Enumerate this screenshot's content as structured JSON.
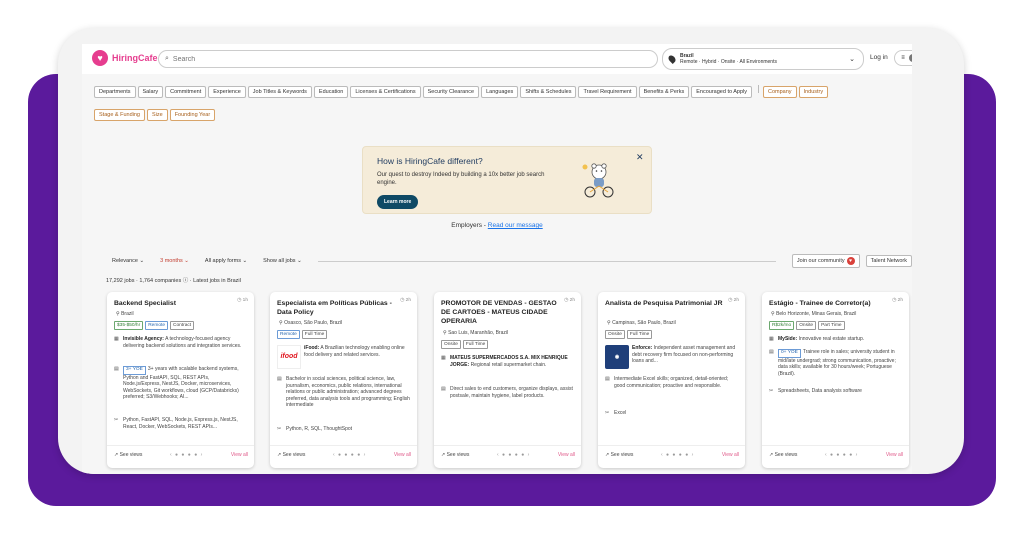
{
  "brand": {
    "name": "HiringCafe",
    "accent": "#e63d8f",
    "frame_bg": "#5b1a9c"
  },
  "search": {
    "placeholder": "Search",
    "value": ""
  },
  "location": {
    "country": "Brazil",
    "modes": "Remote · Hybrid · Onsite · All Environments"
  },
  "header": {
    "login": "Log in",
    "menu_icon": "≡"
  },
  "filters": [
    {
      "label": "Departments"
    },
    {
      "label": "Salary"
    },
    {
      "label": "Commitment"
    },
    {
      "label": "Experience"
    },
    {
      "label": "Job Titles & Keywords"
    },
    {
      "label": "Education"
    },
    {
      "label": "Licenses & Certifications"
    },
    {
      "label": "Security Clearance"
    },
    {
      "label": "Languages"
    },
    {
      "label": "Shifts & Schedules"
    },
    {
      "label": "Travel Requirement"
    },
    {
      "label": "Benefits & Perks"
    },
    {
      "label": "Encouraged to Apply"
    }
  ],
  "company_filters": [
    {
      "label": "Company"
    },
    {
      "label": "Industry"
    },
    {
      "label": "Stage & Funding"
    },
    {
      "label": "Size"
    },
    {
      "label": "Founding Year"
    }
  ],
  "promo": {
    "title": "How is HiringCafe different?",
    "description": "Our quest to destroy Indeed by building a 10x better job search engine.",
    "button": "Learn more",
    "close": "✕"
  },
  "employers": {
    "label": "Employers -",
    "link": "Read our message"
  },
  "toolbar": {
    "relevance": "Relevance",
    "time": "3 months",
    "apply_forms": "All apply forms",
    "show_jobs": "Show all jobs",
    "community": "Join our community",
    "talent": "Talent Network"
  },
  "summary": {
    "count": "17,292 jobs · 1,764 companies",
    "latest": "· Latest jobs in Brazil"
  },
  "cards": [
    {
      "title": "Backend Specialist",
      "time": "1h",
      "location": "Brazil",
      "tags": [
        {
          "text": "$35-$50/hr",
          "style": "green"
        },
        {
          "text": "Remote",
          "style": "blue"
        },
        {
          "text": "Contract",
          "style": ""
        }
      ],
      "company": "Invisible Agency:",
      "company_desc": "A technology-focused agency delivering backend solutions and integration services.",
      "yoe": "3+ YOE",
      "requirements": "3+ years with scalable backend systems, Python and FastAPI, SQL, REST APIs, Node.js/Express, NestJS, Docker, microservices, WebSockets, Git workflows, cloud (GCP/Databricks) preferred; S3/Webhooks; AI...",
      "skills": "Python, FastAPI, SQL, Node.js, Express.js, NestJS, React, Docker, WebSockets, REST APIs...",
      "see_views": "See views",
      "view_all": "View all"
    },
    {
      "title": "Especialista em Políticas Públicas - Data Policy",
      "time": "2h",
      "location": "Osasco, São Paulo, Brazil",
      "tags": [
        {
          "text": "Remote",
          "style": "blue"
        },
        {
          "text": "Full Time",
          "style": ""
        }
      ],
      "logo": "ifood",
      "company": "iFood:",
      "company_desc": "A Brazilian technology enabling online food delivery and related services.",
      "requirements": "Bachelor in social sciences, political science, law, journalism, economics, public relations, international relations or public administration; advanced degrees preferred, data analysis tools and programming; English intermediate",
      "skills": "Python, R, SQL, ThoughtSpot",
      "see_views": "See views",
      "view_all": "View all"
    },
    {
      "title": "PROMOTOR DE VENDAS - GESTAO DE CARTOES - MATEUS CIDADE OPERARIA",
      "time": "2h",
      "location": "Sao Luis, Maranhão, Brazil",
      "tags": [
        {
          "text": "Onsite",
          "style": ""
        },
        {
          "text": "Full Time",
          "style": ""
        }
      ],
      "company": "MATEUS SUPERMERCADOS S.A. MIX HENRIQUE JORGE:",
      "company_desc": "Regional retail supermarket chain.",
      "requirements": "Direct sales to end customers, organize displays, assist postsale, maintain hygiene, label products.",
      "see_views": "See views",
      "view_all": "View all"
    },
    {
      "title": "Analista de Pesquisa Patrimonial JR",
      "time": "2h",
      "location": "Campinas, São Paulo, Brazil",
      "tags": [
        {
          "text": "Onsite",
          "style": ""
        },
        {
          "text": "Full Time",
          "style": ""
        }
      ],
      "logo": "enforce",
      "company": "Enforce:",
      "company_desc": "Independent asset management and debt recovery firm focused on non-performing loans and...",
      "requirements": "Intermediate Excel skills; organized, detail-oriented; good communication; proactive and responsible.",
      "skills": "Excel",
      "see_views": "See views",
      "view_all": "View all"
    },
    {
      "title": "Estágio - Trainee de Corretor(a)",
      "time": "2h",
      "location": "Belo Horizonte, Minas Gerais, Brazil",
      "tags": [
        {
          "text": "R$2k/mo",
          "style": "green"
        },
        {
          "text": "Onsite",
          "style": ""
        },
        {
          "text": "Part Time",
          "style": ""
        }
      ],
      "company": "MySide:",
      "company_desc": "Innovative real estate startup.",
      "yoe": "0+ YOE",
      "requirements": "Trainee role in sales; university student in mid/late undergrad; strong communication, proactive; data skills; available for 30 hours/week; Portuguese (Brazil).",
      "skills": "Spreadsheets, Data analysis software",
      "see_views": "See views",
      "view_all": "View all"
    }
  ]
}
